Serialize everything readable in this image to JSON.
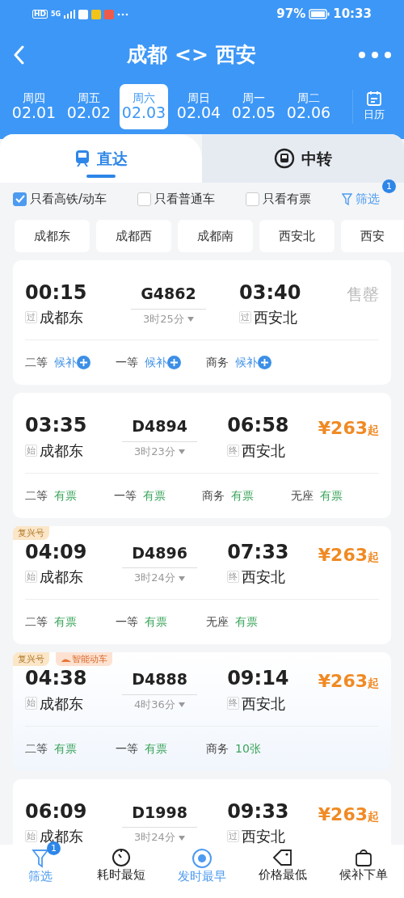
{
  "status_bar": {
    "badges": [
      "HD",
      "5G"
    ],
    "battery": "97%",
    "time": "10:33"
  },
  "header": {
    "title": "成都 <> 西安"
  },
  "dates": [
    {
      "weekday": "周四",
      "date": "02.01",
      "selected": false
    },
    {
      "weekday": "周五",
      "date": "02.02",
      "selected": false
    },
    {
      "weekday": "周六",
      "date": "02.03",
      "selected": true
    },
    {
      "weekday": "周日",
      "date": "02.04",
      "selected": false
    },
    {
      "weekday": "周一",
      "date": "02.05",
      "selected": false
    },
    {
      "weekday": "周二",
      "date": "02.06",
      "selected": false
    }
  ],
  "calendar_button": {
    "label": "日历"
  },
  "tabs": [
    {
      "label": "直达",
      "selected": true
    },
    {
      "label": "中转",
      "selected": false
    }
  ],
  "filters": [
    {
      "label": "只看高铁/动车",
      "checked": true
    },
    {
      "label": "只看普通车",
      "checked": false
    },
    {
      "label": "只看有票",
      "checked": false
    }
  ],
  "filter_link": {
    "label": "筛选",
    "badge": "1"
  },
  "stations": [
    "成都东",
    "成都西",
    "成都南",
    "西安北",
    "西安"
  ],
  "trains": [
    {
      "depart": "00:15",
      "train_no": "G4862",
      "arrive": "03:40",
      "from_tag": "过",
      "from": "成都东",
      "duration": "3时25分",
      "to_tag": "过",
      "to": "西安北",
      "fare": {
        "kind": "sold_out",
        "text": "售罄"
      },
      "seats": [
        {
          "class": "二等",
          "status": "候补",
          "kind": "waitlist"
        },
        {
          "class": "一等",
          "status": "候补",
          "kind": "waitlist"
        },
        {
          "class": "商务",
          "status": "候补",
          "kind": "waitlist"
        }
      ]
    },
    {
      "depart": "03:35",
      "train_no": "D4894",
      "arrive": "06:58",
      "from_tag": "始",
      "from": "成都东",
      "duration": "3时23分",
      "to_tag": "终",
      "to": "西安北",
      "fare": {
        "kind": "price",
        "amount": "¥263",
        "suffix": "起"
      },
      "seats": [
        {
          "class": "二等",
          "status": "有票",
          "kind": "available"
        },
        {
          "class": "一等",
          "status": "有票",
          "kind": "available"
        },
        {
          "class": "商务",
          "status": "有票",
          "kind": "available"
        },
        {
          "class": "无座",
          "status": "有票",
          "kind": "available"
        }
      ]
    },
    {
      "tags": [
        {
          "text": "复兴号",
          "kind": "plain"
        }
      ],
      "depart": "04:09",
      "train_no": "D4896",
      "arrive": "07:33",
      "from_tag": "始",
      "from": "成都东",
      "duration": "3时24分",
      "to_tag": "终",
      "to": "西安北",
      "fare": {
        "kind": "price",
        "amount": "¥263",
        "suffix": "起"
      },
      "seats": [
        {
          "class": "二等",
          "status": "有票",
          "kind": "available"
        },
        {
          "class": "一等",
          "status": "有票",
          "kind": "available"
        },
        {
          "class": "无座",
          "status": "有票",
          "kind": "available"
        }
      ]
    },
    {
      "tags": [
        {
          "text": "复兴号",
          "kind": "plain"
        },
        {
          "text": "智能动车",
          "kind": "smart"
        }
      ],
      "depart": "04:38",
      "train_no": "D4888",
      "arrive": "09:14",
      "from_tag": "始",
      "from": "成都东",
      "duration": "4时36分",
      "to_tag": "终",
      "to": "西安北",
      "fare": {
        "kind": "price",
        "amount": "¥263",
        "suffix": "起"
      },
      "seats": [
        {
          "class": "二等",
          "status": "有票",
          "kind": "available"
        },
        {
          "class": "一等",
          "status": "有票",
          "kind": "available"
        },
        {
          "class": "商务",
          "status": "10张",
          "kind": "available"
        }
      ]
    },
    {
      "depart": "06:09",
      "train_no": "D1998",
      "arrive": "09:33",
      "from_tag": "始",
      "from": "成都东",
      "duration": "3时24分",
      "to_tag": "过",
      "to": "西安北",
      "fare": {
        "kind": "price",
        "amount": "¥263",
        "suffix": "起"
      }
    }
  ],
  "bottom_nav": [
    {
      "label": "筛选",
      "badge": "1",
      "selected": true
    },
    {
      "label": "耗时最短",
      "selected": false
    },
    {
      "label": "发时最早",
      "selected": true
    },
    {
      "label": "价格最低",
      "selected": false
    },
    {
      "label": "候补下单",
      "selected": false
    }
  ]
}
